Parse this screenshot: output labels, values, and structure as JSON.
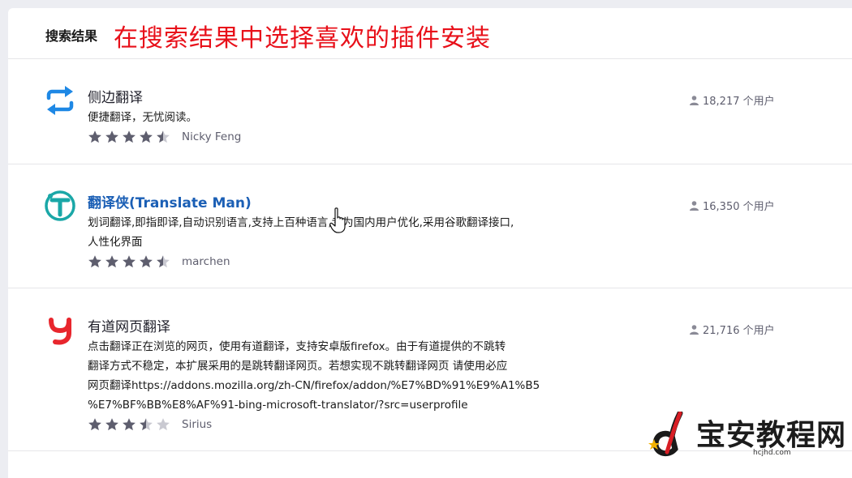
{
  "header": {
    "title": "搜索结果",
    "annotation": "在搜索结果中选择喜欢的插件安装"
  },
  "colors": {
    "accent_link": "#1b5fb5",
    "annotation_red": "#e8101a",
    "star_filled": "#5e5e6e",
    "star_empty": "#c9c9d1"
  },
  "results": [
    {
      "name": "侧边翻译",
      "summary_lines": [
        "便捷翻译，无忧阅读。"
      ],
      "rating": 4.5,
      "author": "Nicky Feng",
      "users": "18,217 个用户",
      "icon": "swap-arrows-icon"
    },
    {
      "name": "翻译侠(Translate Man)",
      "summary_lines": [
        "划词翻译,即指即译,自动识别语言,支持上百种语言,专为国内用户优化,采用谷歌翻译接口,",
        "人性化界面"
      ],
      "rating": 4.5,
      "author": "marchen",
      "users": "16,350 个用户",
      "icon": "t-circle-icon"
    },
    {
      "name": "有道网页翻译",
      "summary_lines": [
        "点击翻译正在浏览的网页，使用有道翻译，支持安卓版firefox。由于有道提供的不跳转",
        "翻译方式不稳定，本扩展采用的是跳转翻译网页。若想实现不跳转翻译网页 请使用必应",
        "网页翻译https://addons.mozilla.org/zh-CN/firefox/addon/%E7%BD%91%E9%A1%B5",
        "%E7%BF%BB%E8%AF%91-bing-microsoft-translator/?src=userprofile"
      ],
      "rating": 3.5,
      "author": "Sirius",
      "users": "21,716 个用户",
      "icon": "youdao-logo-icon"
    }
  ],
  "watermark": {
    "text": "宝安教程网",
    "url": "hcjhd.com"
  }
}
